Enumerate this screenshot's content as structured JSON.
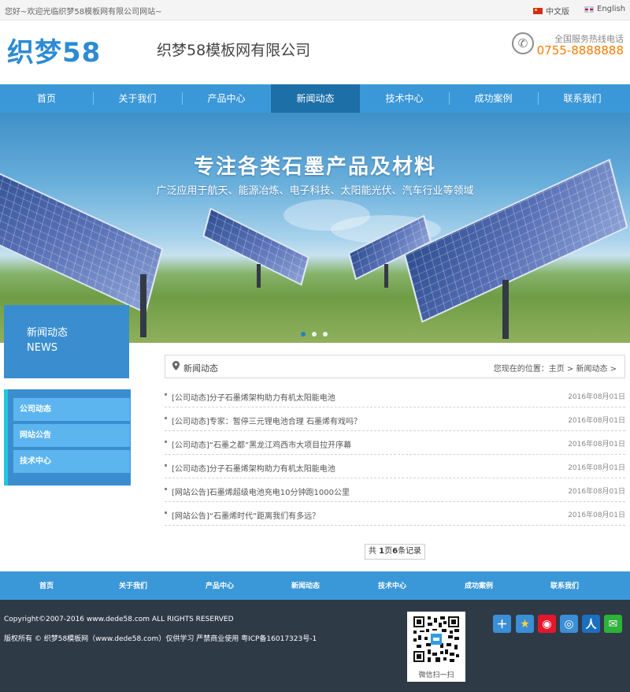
{
  "topbar": {
    "welcome": "您好~欢迎光临织梦58模板网有限公司网站~",
    "lang_cn": "中文版",
    "lang_en": "English"
  },
  "header": {
    "logo": "织梦58",
    "company": "织梦58模板网有限公司",
    "hotline_label": "全国服务热线电话",
    "hotline_number": "0755-8888888"
  },
  "nav": {
    "items": [
      "首页",
      "关于我们",
      "产品中心",
      "新闻动态",
      "技术中心",
      "成功案例",
      "联系我们"
    ],
    "active_index": 3
  },
  "banner": {
    "title": "专注各类石墨产品及材料",
    "subtitle": "广泛应用于航天、能源冶炼、电子科技、太阳能光伏、汽车行业等领域",
    "slide_count": 3,
    "active_slide": 0
  },
  "sidebar": {
    "title_cn": "新闻动态",
    "title_en": "NEWS",
    "items": [
      "公司动态",
      "网站公告",
      "技术中心"
    ]
  },
  "content": {
    "section": "新闻动态",
    "location_label": "您现在的位置：",
    "location_path": "主页 > 新闻动态 >",
    "news": [
      {
        "title": "[公司动态]分子石墨烯架构助力有机太阳能电池",
        "date": "2016年08月01日"
      },
      {
        "title": "[公司动态]专家：暂停三元锂电池合理 石墨烯有戏吗？",
        "date": "2016年08月01日"
      },
      {
        "title": "[公司动态]“石墨之都”黑龙江鸡西市大项目拉开序幕",
        "date": "2016年08月01日"
      },
      {
        "title": "[公司动态]分子石墨烯架构助力有机太阳能电池",
        "date": "2016年08月01日"
      },
      {
        "title": "[网站公告]石墨烯超级电池充电10分钟跑1000公里",
        "date": "2016年08月01日"
      },
      {
        "title": "[网站公告]“石墨烯时代”距离我们有多远？",
        "date": "2016年08月01日"
      }
    ],
    "pager": {
      "prefix": "共 ",
      "pages": "1",
      "mid": "页",
      "records": "6",
      "suffix": "条记录"
    }
  },
  "footer_nav": {
    "items": [
      "首页",
      "关于我们",
      "产品中心",
      "新闻动态",
      "技术中心",
      "成功案例",
      "联系我们"
    ]
  },
  "footer": {
    "copyright": "Copyright©2007-2016 www.dede58.com ALL RIGHTS RESERVED",
    "rights": "版权所有 © 织梦58模板网（www.dede58.com）仅供学习 严禁商业使用 粤ICP备16017323号-1",
    "qr_label": "微信扫一扫",
    "share_icons": [
      {
        "name": "plus-share-icon",
        "glyph": "＋",
        "color": "#3a8fd6"
      },
      {
        "name": "qzone-icon",
        "glyph": "★",
        "color": "#3a8fd6"
      },
      {
        "name": "weibo-icon",
        "glyph": "◉",
        "color": "#e6162d"
      },
      {
        "name": "tencent-weibo-icon",
        "glyph": "◎",
        "color": "#3a8fd6"
      },
      {
        "name": "renren-icon",
        "glyph": "人",
        "color": "#1b6ec0"
      },
      {
        "name": "wechat-icon",
        "glyph": "✉",
        "color": "#2fb23a"
      }
    ]
  }
}
